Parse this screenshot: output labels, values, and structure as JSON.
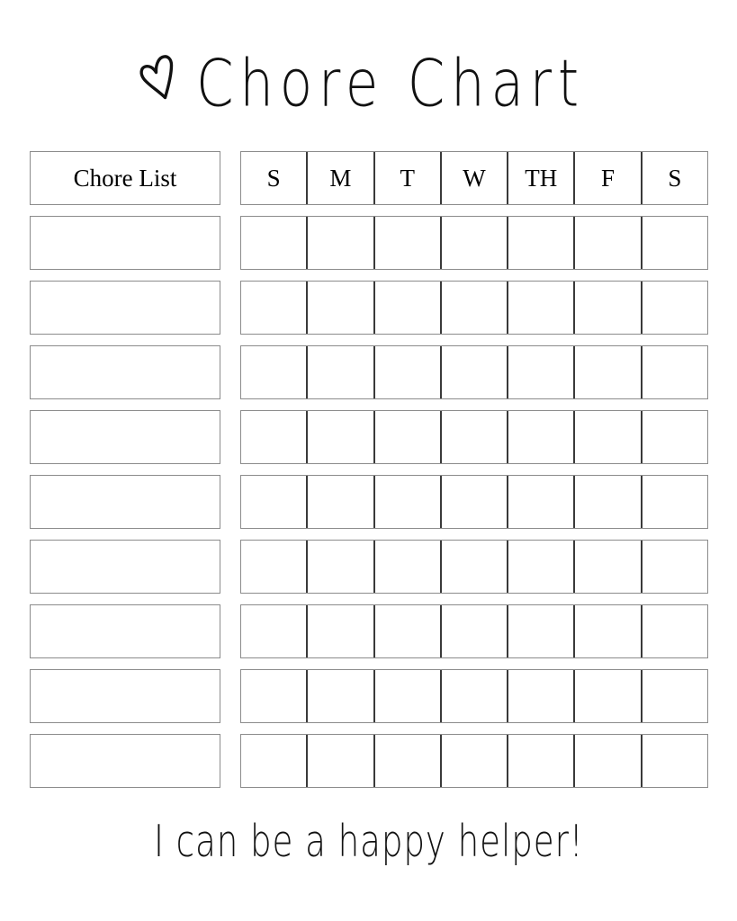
{
  "page": {
    "background_color": "#ffffff",
    "ink_color": "#000000",
    "border_color": "#8c8c8c",
    "grid_divider_color": "#3a3a3a"
  },
  "header": {
    "heart_icon": "heart-icon",
    "title": "Chore Chart"
  },
  "table": {
    "chore_column_header": "Chore List",
    "day_headers": [
      "S",
      "M",
      "T",
      "W",
      "TH",
      "F",
      "S"
    ],
    "row_count": 9,
    "rows": [
      {
        "chore": "",
        "days": [
          "",
          "",
          "",
          "",
          "",
          "",
          ""
        ]
      },
      {
        "chore": "",
        "days": [
          "",
          "",
          "",
          "",
          "",
          "",
          ""
        ]
      },
      {
        "chore": "",
        "days": [
          "",
          "",
          "",
          "",
          "",
          "",
          ""
        ]
      },
      {
        "chore": "",
        "days": [
          "",
          "",
          "",
          "",
          "",
          "",
          ""
        ]
      },
      {
        "chore": "",
        "days": [
          "",
          "",
          "",
          "",
          "",
          "",
          ""
        ]
      },
      {
        "chore": "",
        "days": [
          "",
          "",
          "",
          "",
          "",
          "",
          ""
        ]
      },
      {
        "chore": "",
        "days": [
          "",
          "",
          "",
          "",
          "",
          "",
          ""
        ]
      },
      {
        "chore": "",
        "days": [
          "",
          "",
          "",
          "",
          "",
          "",
          ""
        ]
      },
      {
        "chore": "",
        "days": [
          "",
          "",
          "",
          "",
          "",
          "",
          ""
        ]
      }
    ]
  },
  "footer": {
    "message": "I can be a happy helper!"
  }
}
